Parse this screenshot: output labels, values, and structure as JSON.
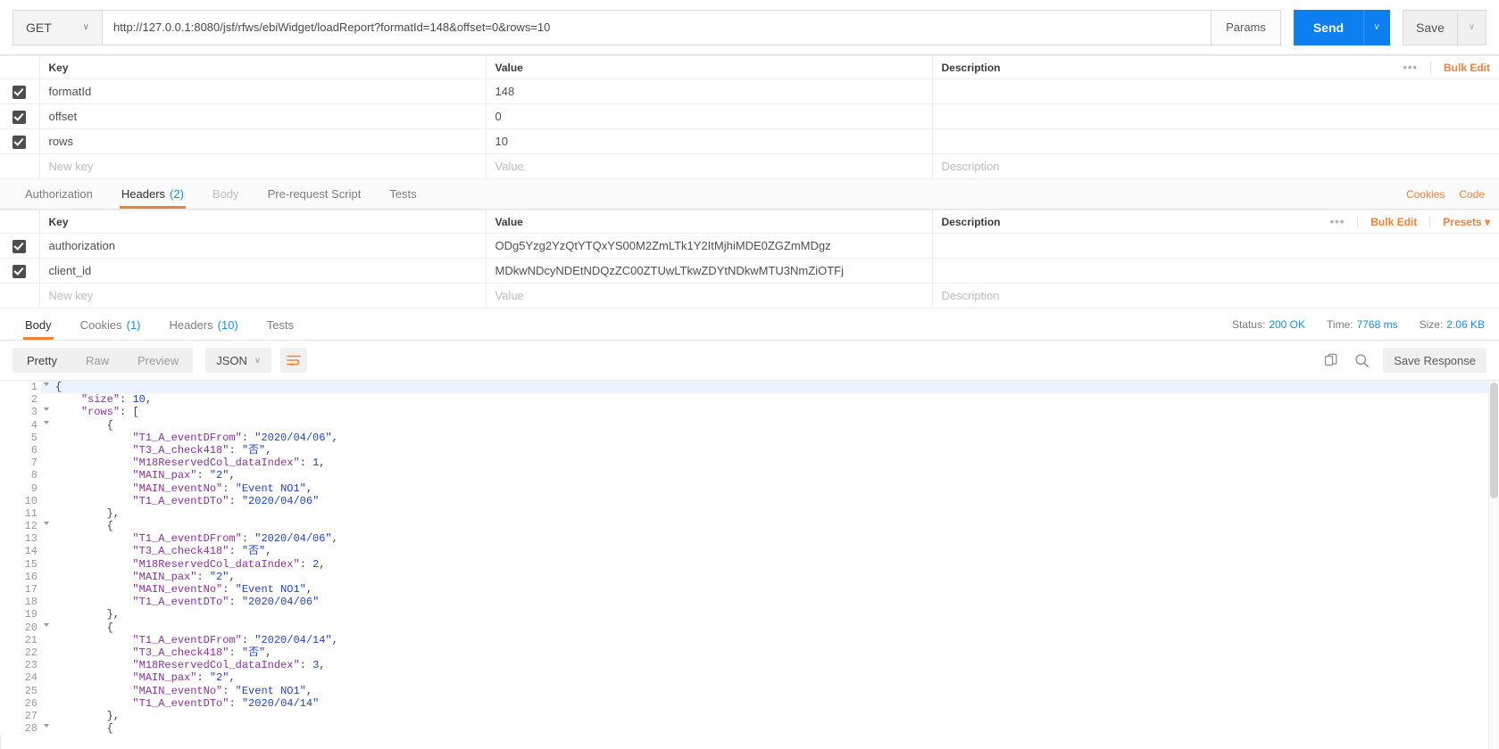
{
  "request_bar": {
    "method": "GET",
    "method_caret": "∨",
    "url": "http://127.0.0.1:8080/jsf/rfws/ebiWidget/loadReport?formatId=148&offset=0&rows=10",
    "params_label": "Params",
    "send_label": "Send",
    "send_caret": "∨",
    "save_label": "Save",
    "save_caret": "∨"
  },
  "params_table": {
    "columns": [
      "Key",
      "Value",
      "Description"
    ],
    "rows": [
      {
        "checked": true,
        "key": "formatId",
        "value": "148",
        "description": ""
      },
      {
        "checked": true,
        "key": "offset",
        "value": "0",
        "description": ""
      },
      {
        "checked": true,
        "key": "rows",
        "value": "10",
        "description": ""
      }
    ],
    "new_row": {
      "key": "New key",
      "value": "Value",
      "description": "Description"
    },
    "dots": "•••",
    "bulk_edit": "Bulk Edit"
  },
  "request_tabs": {
    "items": [
      {
        "label": "Authorization",
        "count": "",
        "active": false,
        "dim": false
      },
      {
        "label": "Headers",
        "count": "(2)",
        "active": true,
        "dim": false
      },
      {
        "label": "Body",
        "count": "",
        "active": false,
        "dim": true
      },
      {
        "label": "Pre-request Script",
        "count": "",
        "active": false,
        "dim": false
      },
      {
        "label": "Tests",
        "count": "",
        "active": false,
        "dim": false
      }
    ],
    "cookies_link": "Cookies",
    "code_link": "Code"
  },
  "headers_table": {
    "columns": [
      "Key",
      "Value",
      "Description"
    ],
    "rows": [
      {
        "checked": true,
        "key": "authorization",
        "value": "ODg5Yzg2YzQtYTQxYS00M2ZmLTk1Y2ItMjhiMDE0ZGZmMDgz",
        "description": ""
      },
      {
        "checked": true,
        "key": "client_id",
        "value": "MDkwNDcyNDEtNDQzZC00ZTUwLTkwZDYtNDkwMTU3NmZiOTFj",
        "description": ""
      }
    ],
    "new_row": {
      "key": "New key",
      "value": "Value",
      "description": "Description"
    },
    "dots": "•••",
    "bulk_edit": "Bulk Edit",
    "presets": "Presets ▾"
  },
  "response_tabs": {
    "items": [
      {
        "label": "Body",
        "count": "",
        "active": true
      },
      {
        "label": "Cookies",
        "count": "(1)",
        "active": false
      },
      {
        "label": "Headers",
        "count": "(10)",
        "active": false
      },
      {
        "label": "Tests",
        "count": "",
        "active": false
      }
    ],
    "status_label": "Status:",
    "status_value": "200 OK",
    "time_label": "Time:",
    "time_value": "7768 ms",
    "size_label": "Size:",
    "size_value": "2.06 KB"
  },
  "view_bar": {
    "modes": [
      {
        "label": "Pretty",
        "active": true
      },
      {
        "label": "Raw",
        "active": false
      },
      {
        "label": "Preview",
        "active": false
      }
    ],
    "format": "JSON",
    "format_caret": "∨",
    "wrap_icon": "wrap-lines-icon",
    "copy_icon": "copy-icon",
    "search_icon": "search-icon",
    "save_response": "Save Response"
  },
  "colors": {
    "accent_orange": "#f2813e",
    "send_blue": "#0d7ff1",
    "status_blue": "#1a8cf0"
  },
  "response_body": {
    "lines": [
      {
        "n": 1,
        "fold": true,
        "indent": 0,
        "text": "{"
      },
      {
        "n": 2,
        "fold": false,
        "indent": 1,
        "text": "\"size\": 10,"
      },
      {
        "n": 3,
        "fold": true,
        "indent": 1,
        "text": "\"rows\": ["
      },
      {
        "n": 4,
        "fold": true,
        "indent": 2,
        "text": "{"
      },
      {
        "n": 5,
        "fold": false,
        "indent": 3,
        "text": "\"T1_A_eventDFrom\": \"2020/04/06\","
      },
      {
        "n": 6,
        "fold": false,
        "indent": 3,
        "text": "\"T3_A_check418\": \"否\","
      },
      {
        "n": 7,
        "fold": false,
        "indent": 3,
        "text": "\"M18ReservedCol_dataIndex\": 1,"
      },
      {
        "n": 8,
        "fold": false,
        "indent": 3,
        "text": "\"MAIN_pax\": \"2\","
      },
      {
        "n": 9,
        "fold": false,
        "indent": 3,
        "text": "\"MAIN_eventNo\": \"Event NO1\","
      },
      {
        "n": 10,
        "fold": false,
        "indent": 3,
        "text": "\"T1_A_eventDTo\": \"2020/04/06\""
      },
      {
        "n": 11,
        "fold": false,
        "indent": 2,
        "text": "},"
      },
      {
        "n": 12,
        "fold": true,
        "indent": 2,
        "text": "{"
      },
      {
        "n": 13,
        "fold": false,
        "indent": 3,
        "text": "\"T1_A_eventDFrom\": \"2020/04/06\","
      },
      {
        "n": 14,
        "fold": false,
        "indent": 3,
        "text": "\"T3_A_check418\": \"否\","
      },
      {
        "n": 15,
        "fold": false,
        "indent": 3,
        "text": "\"M18ReservedCol_dataIndex\": 2,"
      },
      {
        "n": 16,
        "fold": false,
        "indent": 3,
        "text": "\"MAIN_pax\": \"2\","
      },
      {
        "n": 17,
        "fold": false,
        "indent": 3,
        "text": "\"MAIN_eventNo\": \"Event NO1\","
      },
      {
        "n": 18,
        "fold": false,
        "indent": 3,
        "text": "\"T1_A_eventDTo\": \"2020/04/06\""
      },
      {
        "n": 19,
        "fold": false,
        "indent": 2,
        "text": "},"
      },
      {
        "n": 20,
        "fold": true,
        "indent": 2,
        "text": "{"
      },
      {
        "n": 21,
        "fold": false,
        "indent": 3,
        "text": "\"T1_A_eventDFrom\": \"2020/04/14\","
      },
      {
        "n": 22,
        "fold": false,
        "indent": 3,
        "text": "\"T3_A_check418\": \"否\","
      },
      {
        "n": 23,
        "fold": false,
        "indent": 3,
        "text": "\"M18ReservedCol_dataIndex\": 3,"
      },
      {
        "n": 24,
        "fold": false,
        "indent": 3,
        "text": "\"MAIN_pax\": \"2\","
      },
      {
        "n": 25,
        "fold": false,
        "indent": 3,
        "text": "\"MAIN_eventNo\": \"Event NO1\","
      },
      {
        "n": 26,
        "fold": false,
        "indent": 3,
        "text": "\"T1_A_eventDTo\": \"2020/04/14\""
      },
      {
        "n": 27,
        "fold": false,
        "indent": 2,
        "text": "},"
      },
      {
        "n": 28,
        "fold": true,
        "indent": 2,
        "text": "{"
      }
    ]
  }
}
